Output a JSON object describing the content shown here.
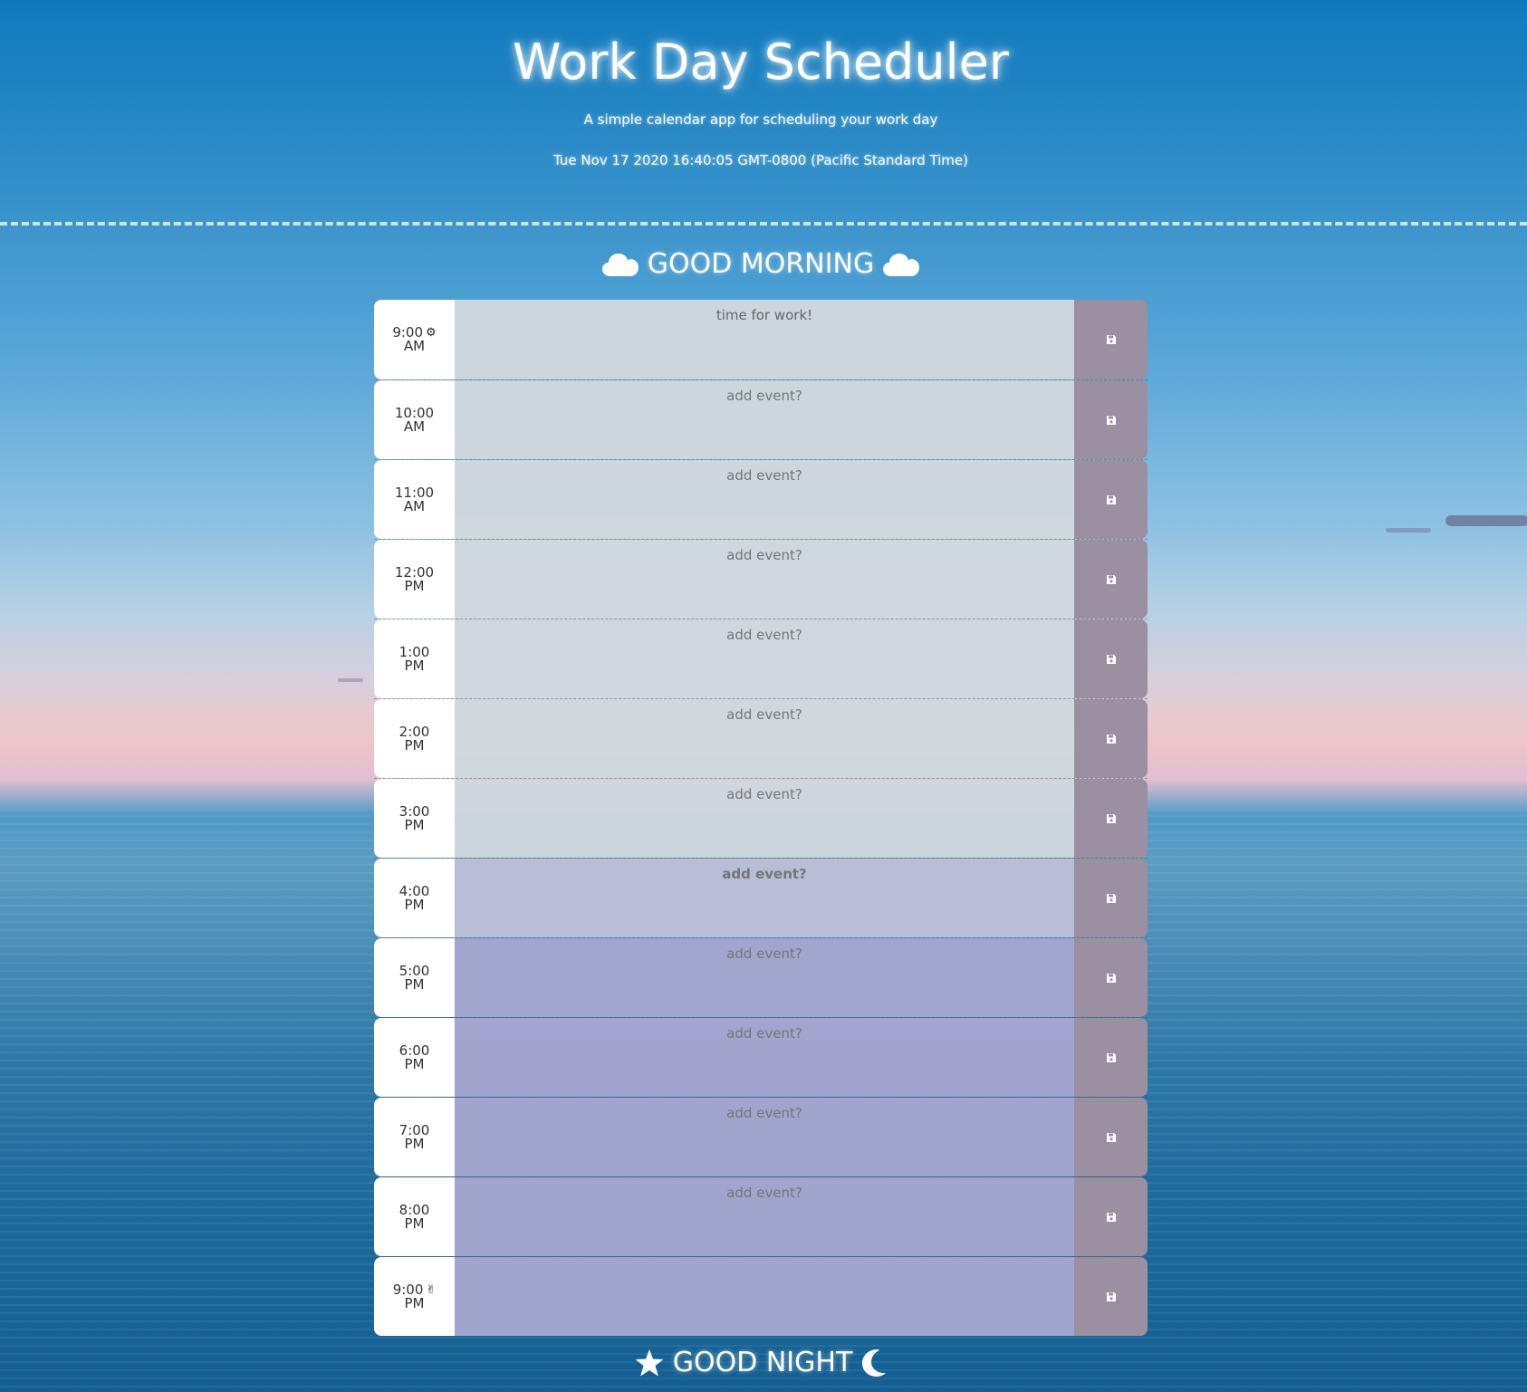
{
  "header": {
    "title": "Work Day Scheduler",
    "subtitle": "A simple calendar app for scheduling your work day",
    "current_datetime": "Tue Nov 17 2020 16:40:05 GMT-0800 (Pacific Standard Time)"
  },
  "greetings": {
    "top": "GOOD MORNING",
    "bottom": "GOOD NIGHT",
    "top_icon": "cloud-icon",
    "bottom_icons": [
      "star-icon",
      "moon-icon"
    ]
  },
  "time_blocks": [
    {
      "hour": "9:00",
      "ampm": "AM",
      "emoji": "⚙",
      "state": "past",
      "text": "time for work!",
      "placeholder": ""
    },
    {
      "hour": "10:00",
      "ampm": "AM",
      "emoji": "",
      "state": "past",
      "text": "",
      "placeholder": "add event?"
    },
    {
      "hour": "11:00",
      "ampm": "AM",
      "emoji": "",
      "state": "past",
      "text": "",
      "placeholder": "add event?"
    },
    {
      "hour": "12:00",
      "ampm": "PM",
      "emoji": "",
      "state": "past",
      "text": "",
      "placeholder": "add event?"
    },
    {
      "hour": "1:00",
      "ampm": "PM",
      "emoji": "",
      "state": "past",
      "text": "",
      "placeholder": "add event?"
    },
    {
      "hour": "2:00",
      "ampm": "PM",
      "emoji": "",
      "state": "past",
      "text": "",
      "placeholder": "add event?"
    },
    {
      "hour": "3:00",
      "ampm": "PM",
      "emoji": "",
      "state": "past",
      "text": "",
      "placeholder": "add event?"
    },
    {
      "hour": "4:00",
      "ampm": "PM",
      "emoji": "",
      "state": "present",
      "text": "",
      "placeholder": "add event?"
    },
    {
      "hour": "5:00",
      "ampm": "PM",
      "emoji": "",
      "state": "future",
      "text": "",
      "placeholder": "add event?"
    },
    {
      "hour": "6:00",
      "ampm": "PM",
      "emoji": "",
      "state": "future",
      "text": "",
      "placeholder": "add event?"
    },
    {
      "hour": "7:00",
      "ampm": "PM",
      "emoji": "",
      "state": "future",
      "text": "",
      "placeholder": "add event?"
    },
    {
      "hour": "8:00",
      "ampm": "PM",
      "emoji": "",
      "state": "future",
      "text": "",
      "placeholder": "add event?"
    },
    {
      "hour": "9:00",
      "ampm": "PM",
      "emoji": "✌",
      "state": "future",
      "text": "",
      "placeholder": ""
    }
  ],
  "save_icon": "save-icon",
  "colors": {
    "past": "#d0d8dd",
    "present": "#bcbfd8",
    "future": "#a3a6cf",
    "save_button": "#9b8fa2",
    "hour_column": "#ffffff"
  }
}
